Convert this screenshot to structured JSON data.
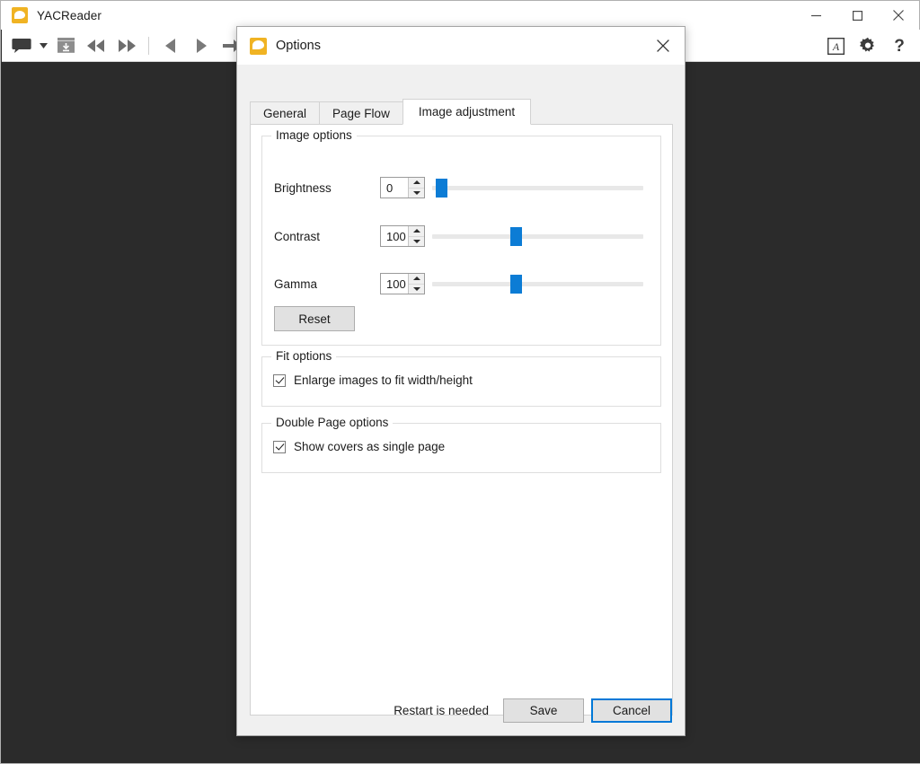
{
  "app": {
    "title": "YACReader",
    "icon": "yacreader-speech-bubble-icon"
  },
  "window_controls": {
    "minimize": "minimize-icon",
    "maximize": "maximize-icon",
    "close": "close-icon"
  },
  "toolbar": {
    "items": [
      {
        "name": "comments-bubble-icon",
        "label": ""
      },
      {
        "name": "dropdown-caret-icon",
        "label": ""
      },
      {
        "name": "open-folder-icon",
        "label": ""
      },
      {
        "name": "first-page-icon",
        "label": ""
      },
      {
        "name": "last-page-icon",
        "label": ""
      },
      {
        "name": "previous-page-icon",
        "label": ""
      },
      {
        "name": "next-page-icon",
        "label": ""
      },
      {
        "name": "go-to-page-icon",
        "label": ""
      },
      {
        "name": "fit-width-icon",
        "label": ""
      }
    ],
    "right_items": [
      {
        "name": "font-options-icon",
        "label": "A"
      },
      {
        "name": "settings-gear-icon",
        "label": ""
      },
      {
        "name": "help-question-icon",
        "label": "?"
      }
    ]
  },
  "dialog": {
    "title": "Options",
    "icon": "yacreader-speech-bubble-icon",
    "close_label": "close-icon",
    "tabs": [
      {
        "label": "General",
        "selected": false
      },
      {
        "label": "Page Flow",
        "selected": false
      },
      {
        "label": "Image adjustment",
        "selected": true
      }
    ],
    "image_options": {
      "group_title": "Image options",
      "sliders": [
        {
          "label": "Brightness",
          "value": "0",
          "handle_percent": 2
        },
        {
          "label": "Contrast",
          "value": "100",
          "handle_percent": 39
        },
        {
          "label": "Gamma",
          "value": "100",
          "handle_percent": 39
        }
      ],
      "reset_label": "Reset"
    },
    "fit_options": {
      "group_title": "Fit options",
      "checkbox_label": "Enlarge images to fit width/height",
      "checked": true
    },
    "double_page_options": {
      "group_title": "Double Page options",
      "checkbox_label": "Show covers as single page",
      "checked": true
    },
    "footer": {
      "restart_note": "Restart is needed",
      "save_label": "Save",
      "cancel_label": "Cancel"
    }
  },
  "colors": {
    "accent": "#0c7cd5",
    "focus_outline": "#0078d7",
    "brand_yellow": "#f0b323",
    "canvas_background": "#2b2b2b"
  }
}
